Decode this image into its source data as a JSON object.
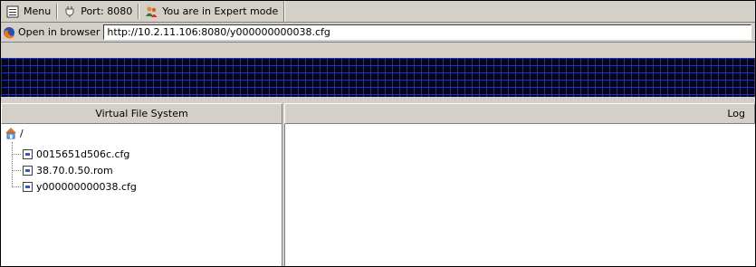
{
  "toolbar": {
    "menu_label": "Menu",
    "port_label": "Port: 8080",
    "mode_label": "You are in Expert mode"
  },
  "address": {
    "open_label": "Open in browser",
    "url": "http://10.2.11.106:8080/y000000000038.cfg"
  },
  "panels": {
    "left_title": "Virtual File System",
    "right_title": "Log"
  },
  "tree": {
    "root": "/",
    "files": [
      "0015651d506c.cfg",
      "38.70.0.50.rom",
      "y000000000038.cfg"
    ]
  },
  "colors": {
    "chrome": "#d4d0c8",
    "banner_bg": "#05051e",
    "banner_grid": "#2837aa"
  }
}
